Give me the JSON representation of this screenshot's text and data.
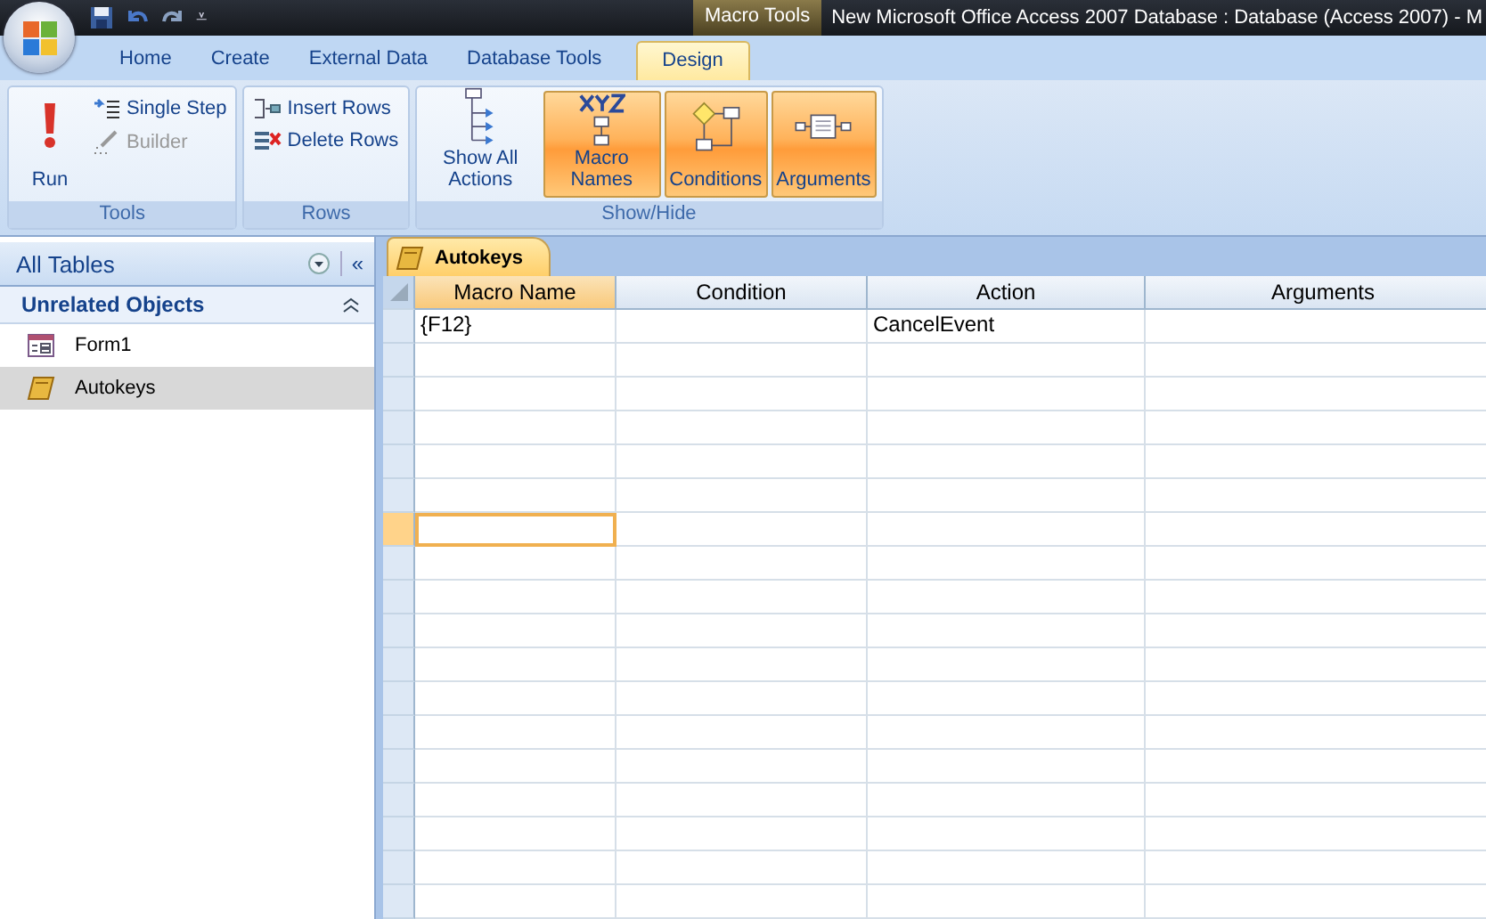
{
  "quick_access": {
    "customize": "⩡"
  },
  "title_bar": {
    "context_label": "Macro Tools",
    "title": "New Microsoft Office Access 2007 Database : Database (Access 2007)  -  M"
  },
  "tabs": [
    {
      "label": "Home",
      "selected": false
    },
    {
      "label": "Create",
      "selected": false
    },
    {
      "label": "External Data",
      "selected": false
    },
    {
      "label": "Database Tools",
      "selected": false
    },
    {
      "label": "Design",
      "selected": true
    }
  ],
  "ribbon": {
    "groups": [
      {
        "label": "Tools",
        "buttons": [
          {
            "kind": "large",
            "label": "Run",
            "disabled": false,
            "selected": false
          },
          {
            "kind": "small",
            "label": "Single Step",
            "disabled": false,
            "selected": false
          },
          {
            "kind": "small",
            "label": "Builder",
            "disabled": true,
            "selected": false
          }
        ]
      },
      {
        "label": "Rows",
        "buttons": [
          {
            "kind": "small",
            "label": "Insert Rows",
            "disabled": false,
            "selected": false
          },
          {
            "kind": "small",
            "label": "Delete Rows",
            "disabled": false,
            "selected": false
          }
        ]
      },
      {
        "label": "Show/Hide",
        "buttons": [
          {
            "kind": "large",
            "label": "Show All Actions",
            "disabled": false,
            "selected": false
          },
          {
            "kind": "large",
            "label": "Macro Names",
            "disabled": false,
            "selected": true
          },
          {
            "kind": "large",
            "label": "Conditions",
            "disabled": false,
            "selected": true
          },
          {
            "kind": "large",
            "label": "Arguments",
            "disabled": false,
            "selected": true
          }
        ]
      }
    ]
  },
  "navigation": {
    "title": "All Tables",
    "collapse": "«",
    "group": {
      "label": "Unrelated Objects",
      "items": [
        {
          "kind": "form",
          "label": "Form1",
          "selected": false
        },
        {
          "kind": "macro",
          "label": "Autokeys",
          "selected": true
        }
      ]
    }
  },
  "document": {
    "tab": "Autokeys",
    "columns": [
      {
        "label": "Macro Name",
        "selected": true
      },
      {
        "label": "Condition",
        "selected": false
      },
      {
        "label": "Action",
        "selected": false
      },
      {
        "label": "Arguments",
        "selected": false
      }
    ],
    "rows": [
      {
        "selected": false,
        "macro_name": "{F12}",
        "action": "CancelEvent"
      },
      {
        "selected": false
      },
      {
        "selected": false
      },
      {
        "selected": false
      },
      {
        "selected": false
      },
      {
        "selected": false
      },
      {
        "selected": true
      },
      {
        "selected": false
      },
      {
        "selected": false
      },
      {
        "selected": false
      },
      {
        "selected": false
      },
      {
        "selected": false
      },
      {
        "selected": false
      },
      {
        "selected": false
      },
      {
        "selected": false
      },
      {
        "selected": false
      },
      {
        "selected": false
      },
      {
        "selected": false
      }
    ]
  }
}
